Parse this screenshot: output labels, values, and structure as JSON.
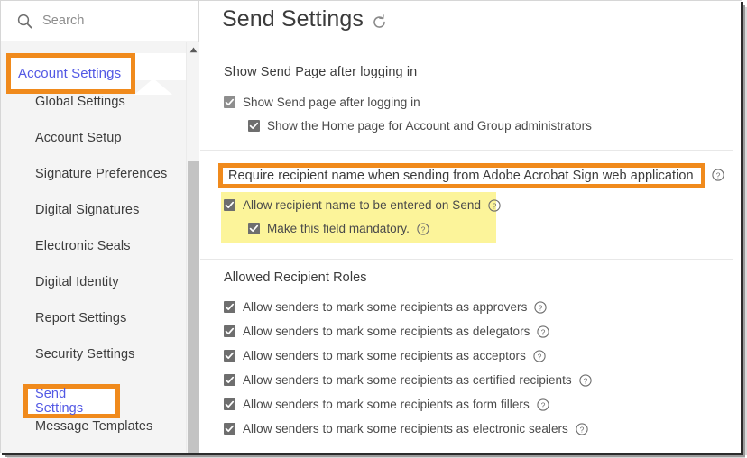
{
  "window": {
    "accent_orange": "#f08a1c",
    "link_blue": "#5258e4",
    "highlight_yellow": "#fcf49a"
  },
  "sidebar": {
    "search": {
      "placeholder": "Search",
      "value": "",
      "icon": "search-icon"
    },
    "group": {
      "label": "Account Settings",
      "expanded": true,
      "chevron_icon": "chevron-up-icon",
      "highlighted": true
    },
    "items": [
      {
        "label": "Global Settings",
        "highlighted": false
      },
      {
        "label": "Account Setup",
        "highlighted": false
      },
      {
        "label": "Signature Preferences",
        "highlighted": false
      },
      {
        "label": "Digital Signatures",
        "highlighted": false
      },
      {
        "label": "Electronic Seals",
        "highlighted": false
      },
      {
        "label": "Digital Identity",
        "highlighted": false
      },
      {
        "label": "Report Settings",
        "highlighted": false
      },
      {
        "label": "Security Settings",
        "highlighted": false
      },
      {
        "label": "Send Settings",
        "highlighted": true
      },
      {
        "label": "Message Templates",
        "highlighted": false
      }
    ],
    "scrollbar": {
      "up_arrow_icon": "caret-up-icon"
    }
  },
  "main": {
    "title": "Send Settings",
    "refresh_icon": "refresh-icon",
    "sections": [
      {
        "heading": "Show Send Page after logging in",
        "options": [
          {
            "label": "Show Send page after logging in",
            "checked": true,
            "help": false
          },
          {
            "label": "Show the Home page for Account and Group administrators",
            "checked": true,
            "help": false
          }
        ]
      },
      {
        "heading": "Require recipient name when sending from Adobe Acrobat Sign web application",
        "heading_highlighted": true,
        "heading_help": true,
        "options": [
          {
            "label": "Allow recipient name to be entered on Send",
            "checked": true,
            "help": true
          },
          {
            "label": "Make this field mandatory.",
            "checked": true,
            "help": true
          }
        ]
      },
      {
        "heading": "Allowed Recipient Roles",
        "options": [
          {
            "label": "Allow senders to mark some recipients as approvers",
            "checked": true,
            "help": true
          },
          {
            "label": "Allow senders to mark some recipients as delegators",
            "checked": true,
            "help": true
          },
          {
            "label": "Allow senders to mark some recipients as acceptors",
            "checked": true,
            "help": true
          },
          {
            "label": "Allow senders to mark some recipients as certified recipients",
            "checked": true,
            "help": true
          },
          {
            "label": "Allow senders to mark some recipients as form fillers",
            "checked": true,
            "help": true
          },
          {
            "label": "Allow senders to mark some recipients as electronic sealers",
            "checked": true,
            "help": true
          }
        ]
      }
    ]
  }
}
